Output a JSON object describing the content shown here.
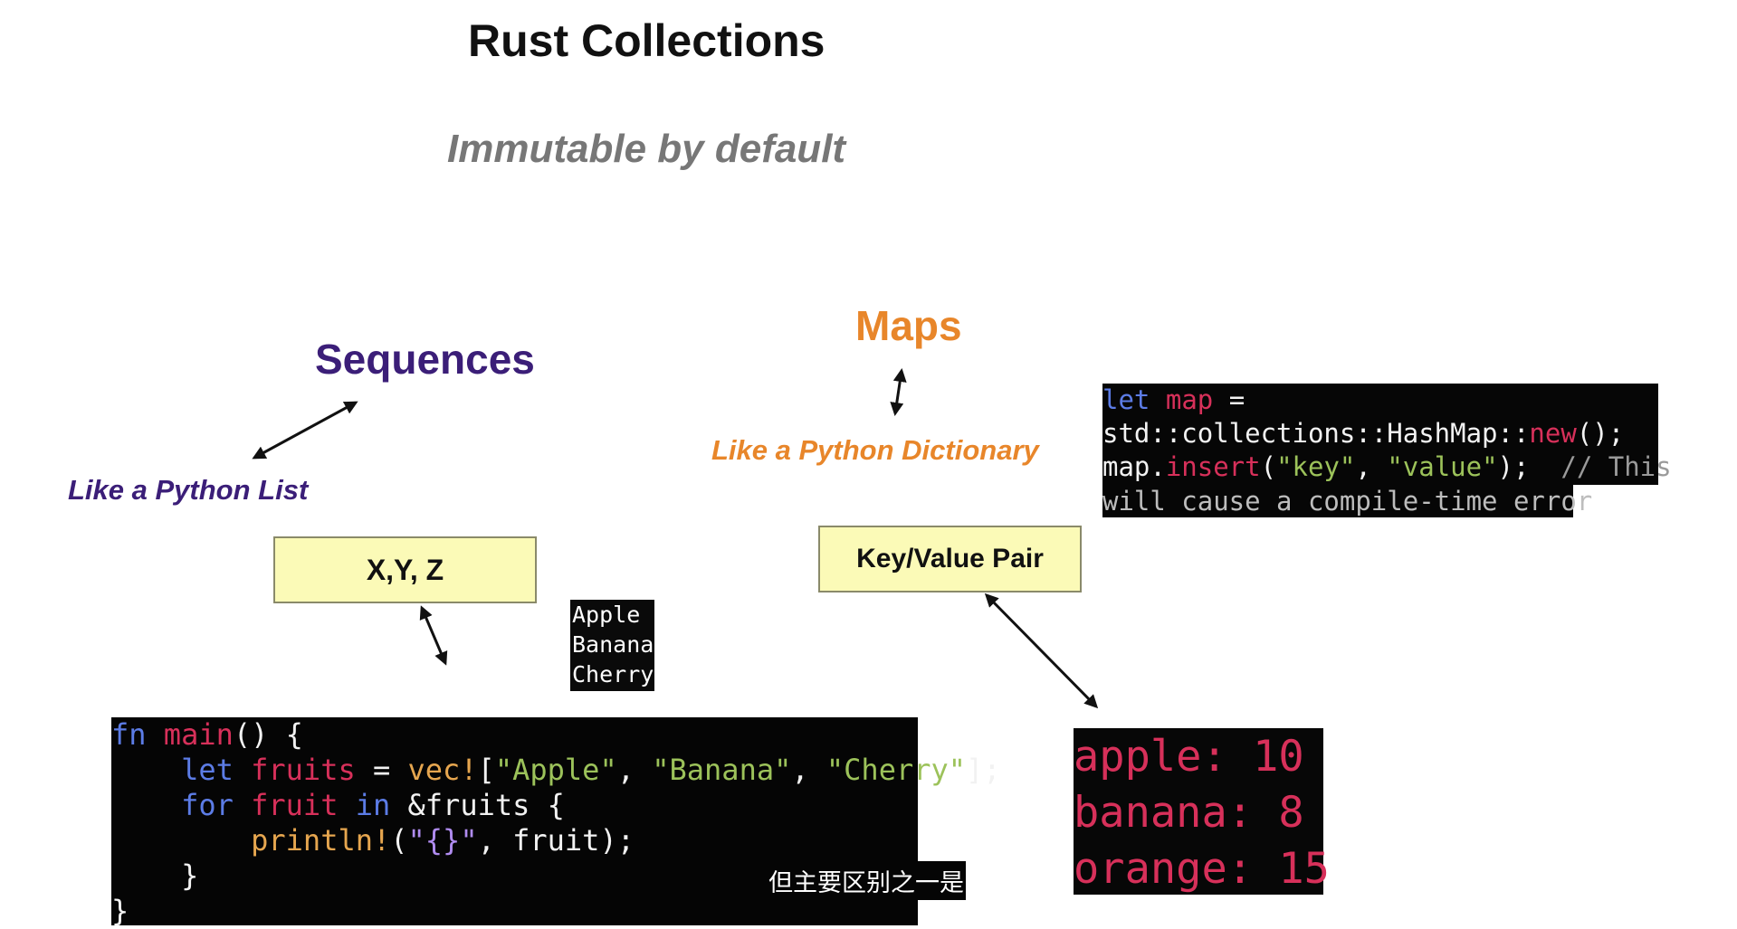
{
  "slide": {
    "title": "Rust Collections",
    "subtitle": "Immutable by default"
  },
  "sequences": {
    "title": "Sequences",
    "like": "Like a Python List",
    "box_label": "X,Y, Z",
    "output_lines": [
      "Apple",
      "Banana",
      "Cherry"
    ],
    "code": {
      "l1": {
        "kw": "fn",
        "name": "main",
        "rest": "() {"
      },
      "l2": {
        "indent": "    ",
        "kw": "let",
        "var": "fruits",
        "eq": " = ",
        "mac": "vec!",
        "open": "[",
        "s1": "\"Apple\"",
        "c1": ", ",
        "s2": "\"Banana\"",
        "c2": ", ",
        "s3": "\"Cherry\"",
        "close": "];"
      },
      "l3": {
        "indent": "    ",
        "kw": "for",
        "var": "fruit",
        "kw2": "in",
        "rest": " &fruits {"
      },
      "l4": {
        "indent": "        ",
        "mac": "println!",
        "open": "(",
        "s": "\"{}\"",
        "rest": ", fruit);"
      },
      "l5": "    }",
      "l6": "}"
    }
  },
  "maps": {
    "title": "Maps",
    "like": "Like a Python Dictionary",
    "box_label": "Key/Value Pair",
    "code": {
      "l1": {
        "kw": "let",
        "var": "map",
        "rest": " ="
      },
      "l2": {
        "pre": "std::collections::HashMap::",
        "fn": "new",
        "rest": "();"
      },
      "l3": {
        "pre": "map.",
        "fn": "insert",
        "open": "(",
        "s1": "\"key\"",
        "c1": ", ",
        "s2": "\"value\"",
        "close": ");  ",
        "cmt": "// This"
      },
      "l4": "will cause a compile-time error"
    },
    "output_lines": [
      "apple: 10",
      "banana: 8",
      "orange: 15"
    ]
  },
  "caption": "但主要区别之一是",
  "colors": {
    "sequences": "#3b1e78",
    "maps": "#e8862a",
    "box_fill": "#fbfab7",
    "keyword": "#5c7ce6",
    "identifier": "#d7305a",
    "string": "#9cc25a",
    "macro": "#e6a64f"
  }
}
